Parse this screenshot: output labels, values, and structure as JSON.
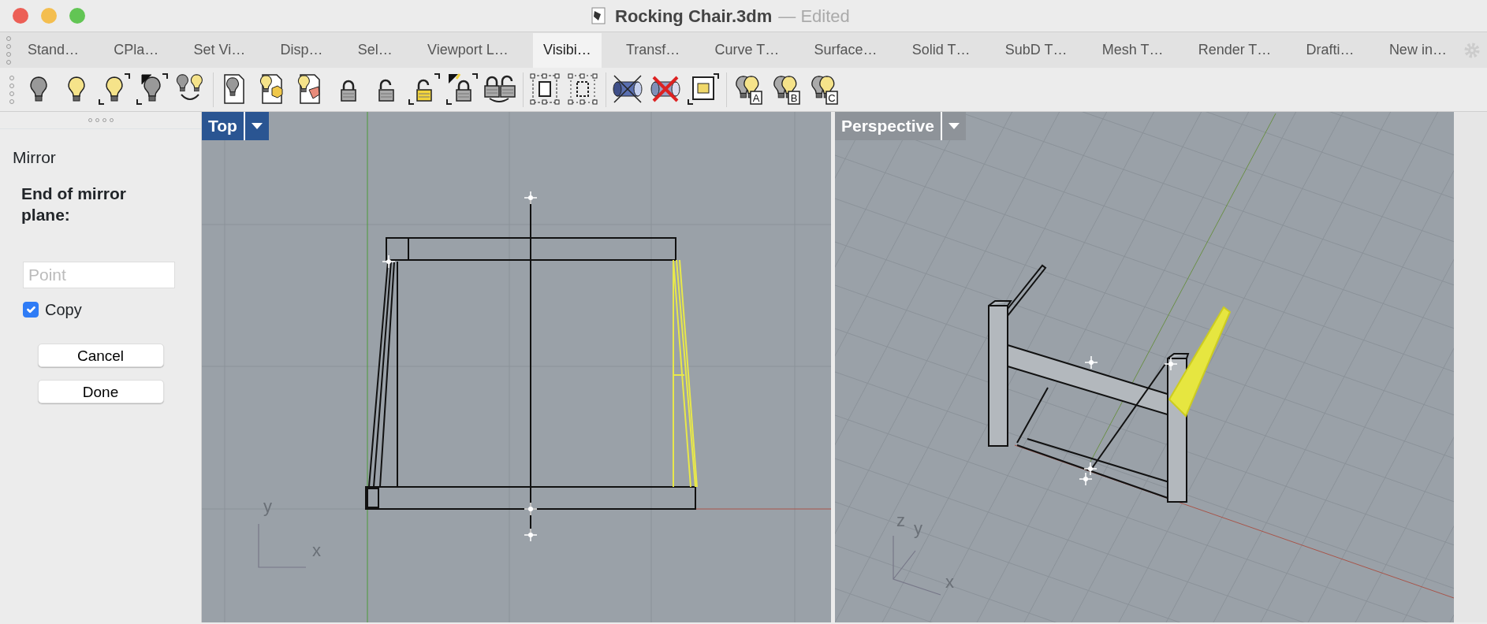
{
  "window": {
    "title": "Rocking Chair.3dm",
    "state": "— Edited"
  },
  "tabs": [
    {
      "label": "Stand…",
      "selected": false
    },
    {
      "label": "CPla…",
      "selected": false
    },
    {
      "label": "Set Vi…",
      "selected": false
    },
    {
      "label": "Disp…",
      "selected": false
    },
    {
      "label": "Sel…",
      "selected": false
    },
    {
      "label": "Viewport L…",
      "selected": false
    },
    {
      "label": "Visibi…",
      "selected": true
    },
    {
      "label": "Transf…",
      "selected": false
    },
    {
      "label": "Curve T…",
      "selected": false
    },
    {
      "label": "Surface…",
      "selected": false
    },
    {
      "label": "Solid T…",
      "selected": false
    },
    {
      "label": "SubD T…",
      "selected": false
    },
    {
      "label": "Mesh T…",
      "selected": false
    },
    {
      "label": "Render T…",
      "selected": false
    },
    {
      "label": "Drafti…",
      "selected": false
    },
    {
      "label": "New in…",
      "selected": false
    }
  ],
  "toolbar": [
    [
      {
        "kind": "bulb-grey"
      },
      {
        "kind": "bulb-yellow"
      },
      {
        "kind": "bulb-corners"
      },
      {
        "kind": "bulb-split"
      },
      {
        "kind": "bulbs-swap"
      }
    ],
    [
      {
        "kind": "page-bulb"
      },
      {
        "kind": "page-hexagon"
      },
      {
        "kind": "page-shape"
      },
      {
        "kind": "lock"
      },
      {
        "kind": "unlock"
      },
      {
        "kind": "unlock-corners"
      },
      {
        "kind": "lock-split"
      },
      {
        "kind": "locks-swap"
      }
    ],
    [
      {
        "kind": "frame"
      },
      {
        "kind": "frame-dashed"
      }
    ],
    [
      {
        "kind": "cylinder"
      },
      {
        "kind": "cylinder-cross"
      },
      {
        "kind": "box-corners"
      }
    ],
    [
      {
        "kind": "bulb-letter",
        "label": "A"
      },
      {
        "kind": "bulb-letter",
        "label": "B"
      },
      {
        "kind": "bulb-letter",
        "label": "C"
      }
    ]
  ],
  "command_panel": {
    "title": "Mirror",
    "prompt": "End of mirror plane:",
    "input": {
      "placeholder": "Point"
    },
    "copy": {
      "label": "Copy",
      "checked": true
    },
    "buttons": [
      "Cancel",
      "Done"
    ]
  },
  "viewports": [
    {
      "kind": "top",
      "title": "Top",
      "selected": true,
      "axis_labels": [
        "x",
        "y"
      ]
    },
    {
      "kind": "perspective",
      "title": "Perspective",
      "selected": false,
      "axis_labels": [
        "x",
        "y",
        "z"
      ]
    }
  ]
}
